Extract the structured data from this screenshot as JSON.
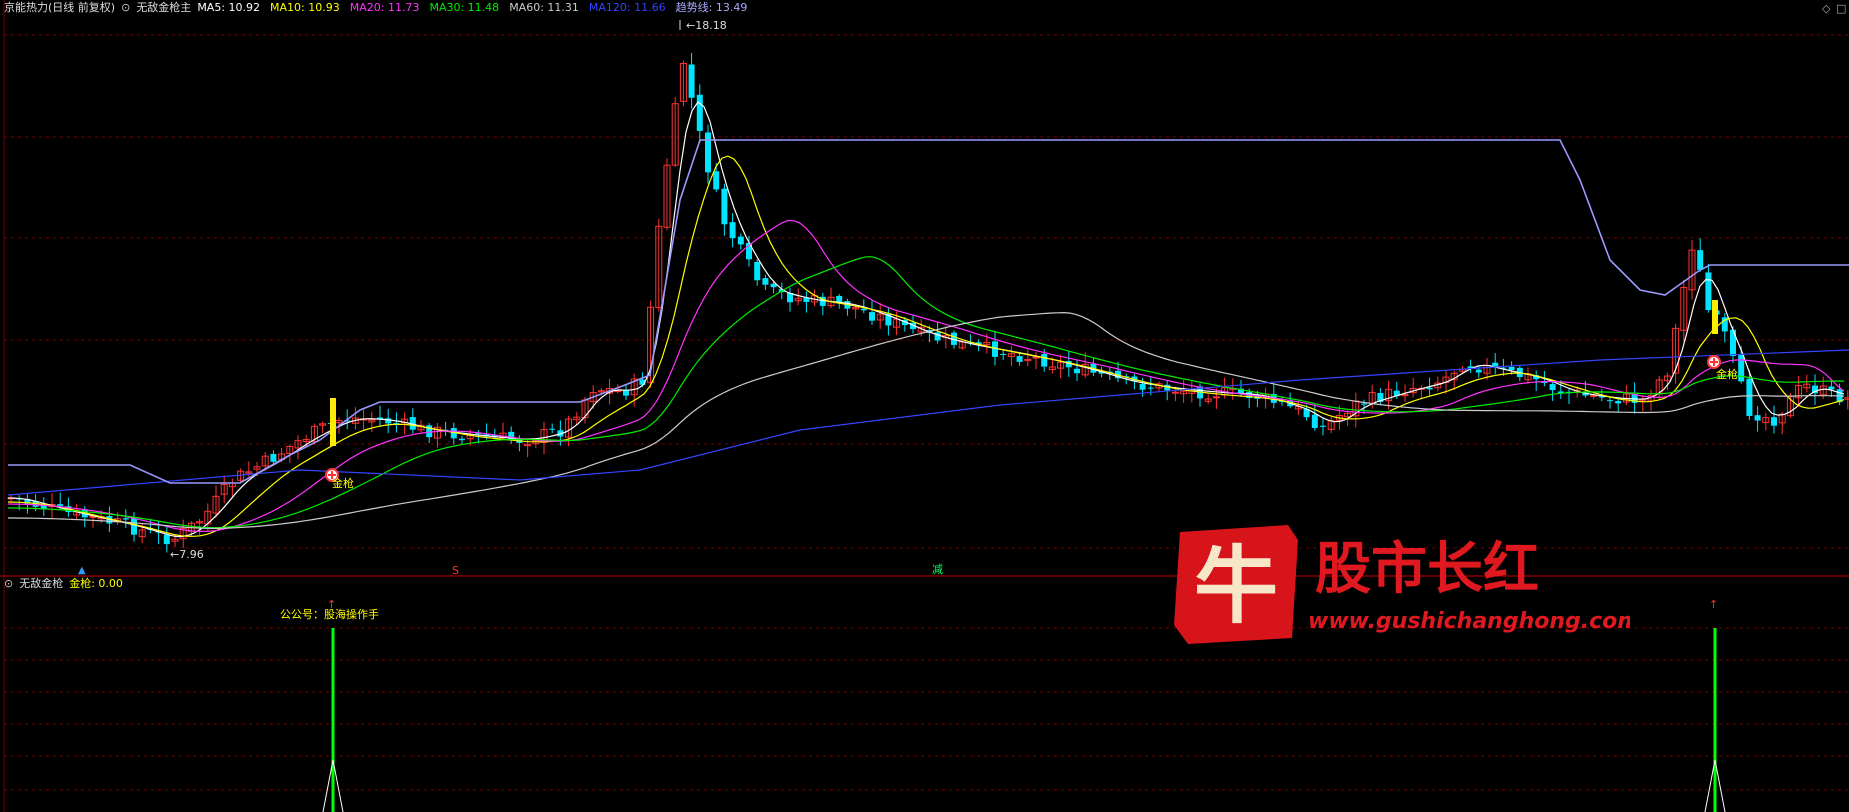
{
  "main_header": {
    "stock": "京能热力(日线 前复权)",
    "indicator": "无敌金枪主",
    "ma": [
      {
        "label": "MA5: 10.92",
        "color": "#ffffff"
      },
      {
        "label": "MA10: 10.93",
        "color": "#ffff00"
      },
      {
        "label": "MA20: 11.73",
        "color": "#ff33ff"
      },
      {
        "label": "MA30: 11.48",
        "color": "#00ee00"
      },
      {
        "label": "MA60: 11.31",
        "color": "#cccccc"
      },
      {
        "label": "MA120: 11.66",
        "color": "#3344ff"
      },
      {
        "label": "趋势线: 13.49",
        "color": "#aaaaff"
      }
    ]
  },
  "sub_header": {
    "indicator": "无敌金枪",
    "value": "金枪: 0.00"
  },
  "annotations": {
    "high_price": "18.18",
    "low_price": "7.96",
    "signal_label": "金枪",
    "wechat": "公公号：股海操作手",
    "marker_jian": "减",
    "marker_s": "S"
  },
  "watermark": {
    "logo_char": "牛",
    "brand": "股市长红",
    "url": "www.gushichanghong.com"
  },
  "colors": {
    "up": "#ff3333",
    "down": "#00e5ff",
    "ma5": "#ffffff",
    "ma10": "#ffff00",
    "ma20": "#ff33ff",
    "ma30": "#00ee00",
    "ma60": "#cccccc",
    "ma120": "#3344ff",
    "trend": "#9999ff",
    "grid": "#7a0000",
    "signal": "#00ff00"
  }
}
